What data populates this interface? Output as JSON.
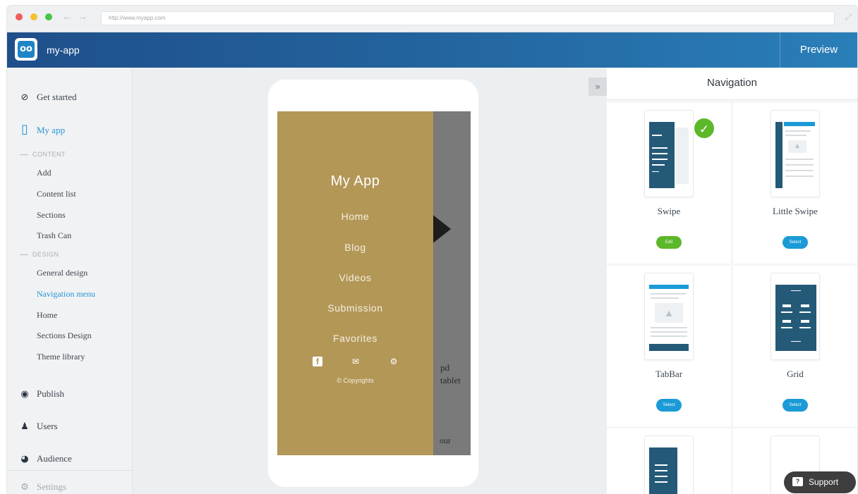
{
  "browser": {
    "url": "http://www.myapp.com",
    "back_icon": "arrow-left",
    "forward_icon": "arrow-right"
  },
  "header": {
    "app_name": "my-app",
    "logo_glyph": "oo",
    "preview_label": "Preview"
  },
  "sidebar": {
    "get_started": "Get started",
    "my_app": "My app",
    "content_section": "CONTENT",
    "content_items": [
      "Add",
      "Content list",
      "Sections",
      "Trash Can"
    ],
    "design_section": "DESIGN",
    "design_items": [
      "General design",
      "Navigation menu",
      "Home",
      "Sections Design",
      "Theme library"
    ],
    "active_item": "Navigation menu",
    "publish": "Publish",
    "users": "Users",
    "audience": "Audience",
    "settings": "Settings"
  },
  "preview": {
    "app_title": "My App",
    "menu_items": [
      "Home",
      "Blog",
      "Videos",
      "Submission",
      "Favorites"
    ],
    "copyright": "© Copyrights",
    "background_text_line1": "pd",
    "background_text_line2": "tablet",
    "background_text_bottom": "our",
    "collapse_icon": "»"
  },
  "panel": {
    "title": "Navigation",
    "options": [
      {
        "label": "Swipe",
        "action": "Edit",
        "selected": true
      },
      {
        "label": "Little Swipe",
        "action": "Select",
        "selected": false
      },
      {
        "label": "TabBar",
        "action": "Select",
        "selected": false
      },
      {
        "label": "Grid",
        "action": "Select",
        "selected": false
      }
    ]
  },
  "support": {
    "label": "Support"
  },
  "colors": {
    "accent": "#2a93d5",
    "drawer": "#b39757",
    "success": "#5cb82a",
    "select": "#1a9bd7"
  }
}
